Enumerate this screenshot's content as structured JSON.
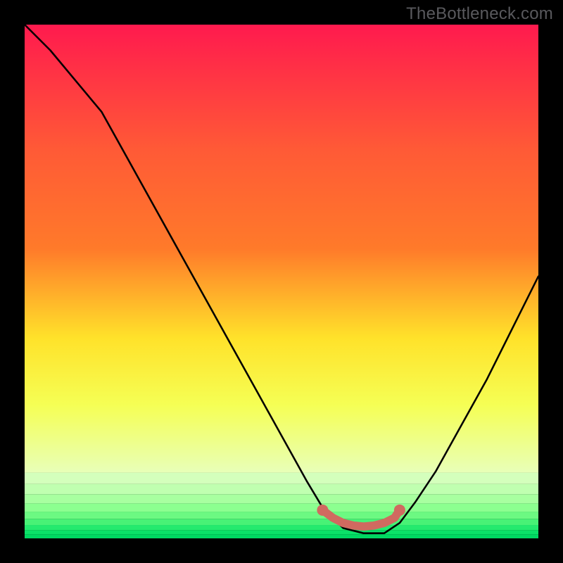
{
  "watermark": "TheBottleneck.com",
  "colors": {
    "background": "#000000",
    "gradient_top": "#ff1a4e",
    "gradient_mid_upper": "#ff7a2a",
    "gradient_mid": "#ffe22a",
    "gradient_mid_lower": "#f5ff55",
    "gradient_low": "#c8ffb0",
    "gradient_bottom": "#00e56a",
    "curve": "#000000",
    "marker": "#d06a60"
  },
  "chart_data": {
    "type": "line",
    "title": "",
    "xlabel": "",
    "ylabel": "",
    "xlim": [
      0,
      100
    ],
    "ylim": [
      0,
      100
    ],
    "curve": {
      "x": [
        0,
        5,
        10,
        15,
        20,
        25,
        30,
        35,
        40,
        45,
        50,
        55,
        58,
        62,
        66,
        70,
        73,
        76,
        80,
        85,
        90,
        95,
        100
      ],
      "y": [
        100,
        95,
        89,
        83,
        74,
        65,
        56,
        47,
        38,
        29,
        20,
        11,
        6,
        2,
        1,
        1,
        3,
        7,
        13,
        22,
        31,
        41,
        51
      ]
    },
    "markers": {
      "x": [
        58,
        60,
        62,
        64,
        66,
        68,
        70,
        72,
        73
      ],
      "y": [
        5.5,
        4.0,
        3.0,
        2.5,
        2.3,
        2.5,
        3.0,
        4.0,
        5.5
      ]
    },
    "bottom_bands_y": [
      0.0,
      0.8,
      1.6,
      2.6,
      3.8,
      5.2,
      6.8,
      8.6,
      10.6,
      12.8
    ]
  }
}
